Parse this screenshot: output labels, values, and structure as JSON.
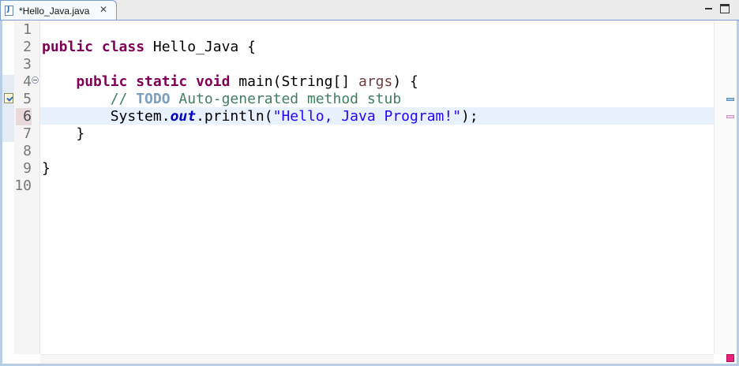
{
  "tab": {
    "title": "*Hello_Java.java",
    "file_icon": "java-file-icon",
    "file_icon_letter": "J",
    "close_glyph": "✕"
  },
  "window_controls": [
    "minimize-icon",
    "maximize-icon"
  ],
  "editor": {
    "current_line": 6,
    "line_numbers": [
      "1",
      "2",
      "3",
      "4",
      "5",
      "6",
      "7",
      "8",
      "9",
      "10"
    ],
    "code": {
      "l2": {
        "kw": "public class",
        "rest": " Hello_Java {"
      },
      "l4": {
        "kw": "public static void",
        "mid": " main(String[] ",
        "param": "args",
        "end": ") {"
      },
      "l5": {
        "comment_start": "// ",
        "todo": "TODO",
        "comment_rest": " Auto-generated method stub"
      },
      "l6": {
        "obj": "System.",
        "field": "out",
        "call": ".println(",
        "string": "\"Hello, Java Program!\"",
        "end": ");"
      },
      "l7": {
        "text": "}"
      },
      "l9": {
        "text": "}"
      }
    }
  },
  "colors": {
    "keyword": "#7f0055",
    "comment": "#3f7f5f",
    "todo": "#7f9fbf",
    "string": "#2a00ff",
    "field": "#0000c0",
    "current_line_bg": "#e8f2fe",
    "error_marker": "#e8207a"
  }
}
